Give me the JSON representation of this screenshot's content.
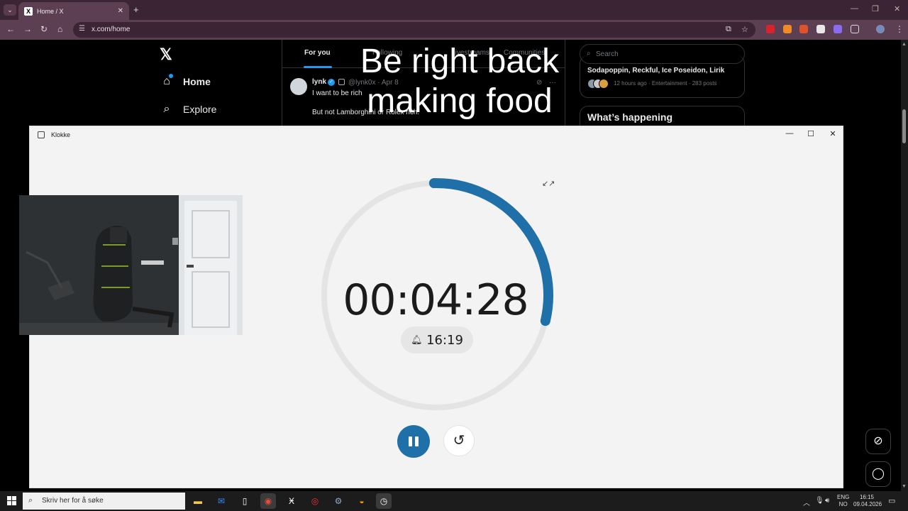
{
  "browser": {
    "tab_title": "Home / X",
    "tab_favicon": "X",
    "url": "x.com/home"
  },
  "x": {
    "logo": "𝕏",
    "nav": [
      {
        "label": "Home",
        "icon": "home-icon"
      },
      {
        "label": "Explore",
        "icon": "search-icon"
      }
    ],
    "tabs": [
      "For you",
      "Following",
      "Livestreams",
      "Communities"
    ],
    "tweet": {
      "name": "lynk",
      "handle": "@lynk0x · Apr 8",
      "line1": "I want to be rich",
      "line2": "But not Lamborghini or Rolex rich."
    },
    "search_placeholder": "Search",
    "trend": {
      "title": "Sodapoppin, Reckful, Ice Poseidon, Lirik",
      "meta": "12 hours ago · Entertainment · 283 posts"
    },
    "whats_happening": "What’s happening"
  },
  "overlay": {
    "line1": "Be right back",
    "line2": "making food"
  },
  "clock_app": {
    "title": "Klokke",
    "timer": "00:04:28",
    "alarm_time": "16:19",
    "progress_fraction": 0.29,
    "accent_color": "#1f6fa8"
  },
  "taskbar": {
    "search_placeholder": "Skriv her for å søke",
    "lang_line1": "ENG",
    "lang_line2": "NO",
    "time": "16:15",
    "date": "09.04.2026"
  }
}
